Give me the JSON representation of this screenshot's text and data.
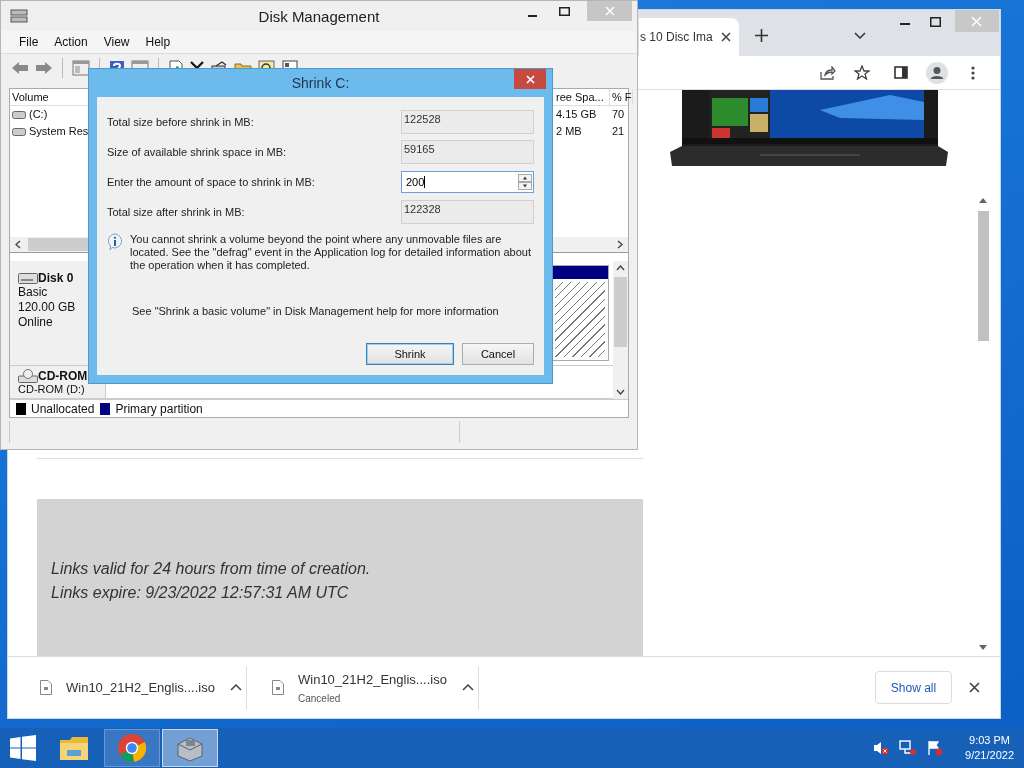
{
  "browser": {
    "tab_title": "s 10 Disc Ima",
    "content_lines": [
      "Links valid for 24 hours from time of creation.",
      "Links expire: 9/23/2022 12:57:31 AM UTC"
    ],
    "downloads": [
      {
        "filename": "Win10_21H2_Englis....iso"
      },
      {
        "filename": "Win10_21H2_Englis....iso",
        "status": "Canceled"
      }
    ],
    "show_all": "Show all"
  },
  "disk_management": {
    "title": "Disk Management",
    "menu": [
      "File",
      "Action",
      "View",
      "Help"
    ],
    "volume_table": {
      "columns": [
        {
          "label": "Volume"
        },
        {
          "label": "ree Spa..."
        },
        {
          "label": "% F"
        }
      ],
      "rows": [
        {
          "cells": [
            "(C:)",
            "4.15 GB",
            "70"
          ]
        },
        {
          "cells": [
            "System Res",
            "2 MB",
            "21"
          ]
        }
      ]
    },
    "disks": [
      {
        "kind": "disk",
        "name": "Disk 0",
        "lines": [
          "Basic",
          "120.00 GB",
          "Online"
        ]
      },
      {
        "kind": "cdrom",
        "name": "CD-ROM",
        "lines": [
          "CD-ROM (D:)"
        ]
      }
    ],
    "legend": [
      {
        "label": "Unallocated",
        "color": "#000000"
      },
      {
        "label": "Primary partition",
        "color": "#000080"
      }
    ]
  },
  "shrink_dialog": {
    "title": "Shrink C:",
    "fields": [
      {
        "label": "Total size before shrink in MB:",
        "value": "122528",
        "editable": false
      },
      {
        "label": "Size of available shrink space in MB:",
        "value": "59165",
        "editable": false
      },
      {
        "label": "Enter the amount of space to shrink in MB:",
        "value": "200",
        "editable": true
      },
      {
        "label": "Total size after shrink in MB:",
        "value": "122328",
        "editable": false
      }
    ],
    "info": "You cannot shrink a volume beyond the point where any unmovable files are located. See the \"defrag\" event in the Application log for detailed information about the operation when it has completed.",
    "help_note": "See \"Shrink a basic volume\" in Disk Management help for more information",
    "buttons": [
      {
        "label": "Shrink",
        "default": true
      },
      {
        "label": "Cancel",
        "default": false
      }
    ]
  },
  "taskbar": {
    "apps": [
      {
        "kind": "folder",
        "open": false,
        "selected": false
      },
      {
        "kind": "chrome",
        "open": true,
        "selected": false
      },
      {
        "kind": "disk",
        "open": true,
        "selected": true
      }
    ],
    "time": "9:03 PM",
    "date": "9/21/2022"
  }
}
